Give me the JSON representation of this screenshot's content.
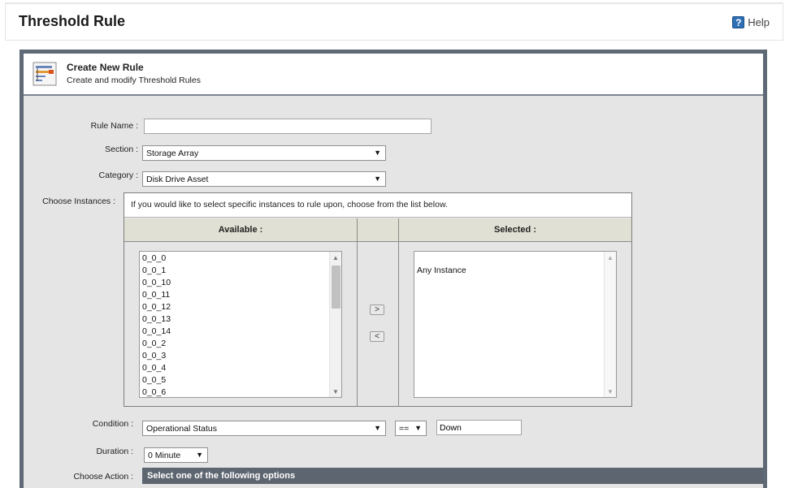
{
  "header": {
    "title": "Threshold Rule",
    "help_label": "Help",
    "help_icon": "question-mark-icon"
  },
  "panel": {
    "icon": "rule-list-icon",
    "title": "Create New Rule",
    "subtitle": "Create and modify Threshold Rules"
  },
  "form": {
    "rule_name": {
      "label": "Rule Name :",
      "value": ""
    },
    "section": {
      "label": "Section :",
      "value": "Storage Array"
    },
    "category": {
      "label": "Category :",
      "value": "Disk Drive Asset"
    },
    "choose_instances": {
      "label": "Choose Instances :",
      "hint": "If you would like to select specific instances to rule upon, choose from the list below.",
      "available_header": "Available :",
      "selected_header": "Selected :",
      "available": [
        "0_0_0",
        "0_0_1",
        "0_0_10",
        "0_0_11",
        "0_0_12",
        "0_0_13",
        "0_0_14",
        "0_0_2",
        "0_0_3",
        "0_0_4",
        "0_0_5",
        "0_0_6"
      ],
      "selected": [
        "Any Instance"
      ],
      "add_icon": "arrow-right-icon",
      "remove_icon": "arrow-left-icon"
    },
    "condition": {
      "label": "Condition :",
      "attribute": "Operational Status",
      "operator": "==",
      "value": "Down"
    },
    "duration": {
      "label": "Duration :",
      "value": "0 Minute"
    },
    "choose_action": {
      "label": "Choose Action :",
      "bar_text": "Select one of the following options"
    }
  }
}
